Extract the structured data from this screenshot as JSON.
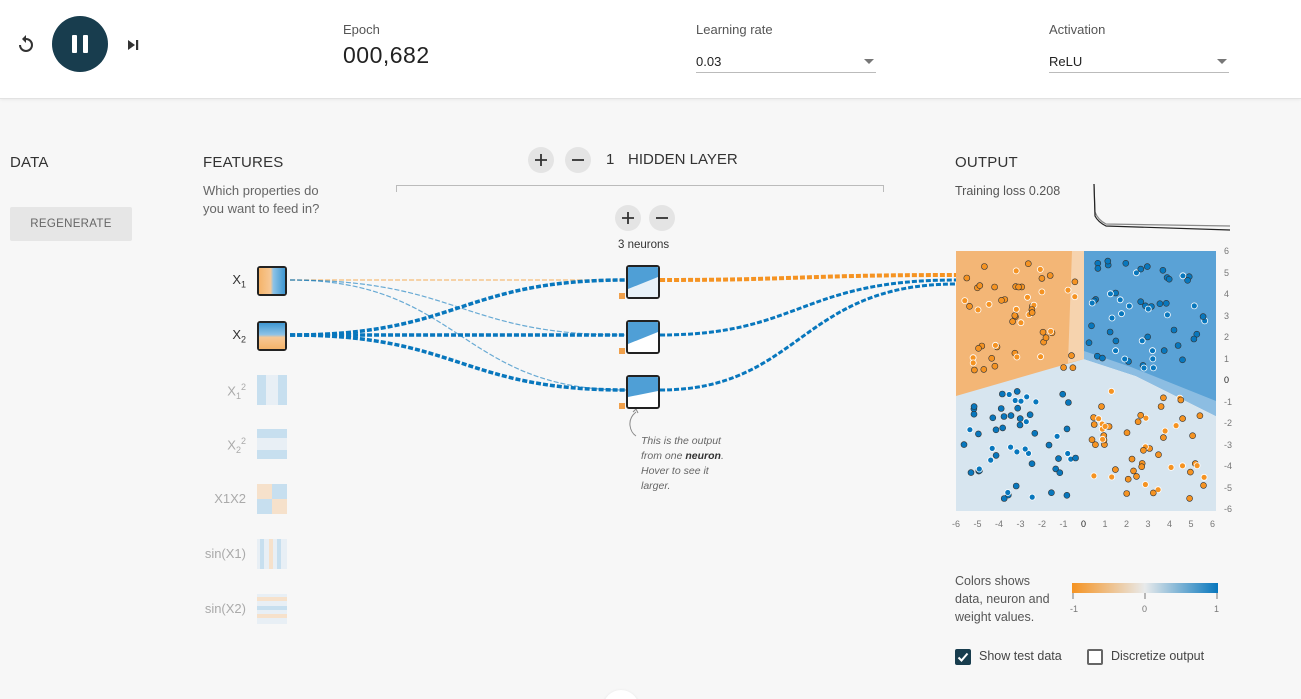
{
  "controls": {
    "reset_icon": "reset-icon",
    "play_pause_icon": "pause-icon",
    "step_icon": "step-forward-icon"
  },
  "epoch": {
    "label": "Epoch",
    "value": "000,682"
  },
  "learning_rate": {
    "label": "Learning rate",
    "value": "0.03"
  },
  "activation": {
    "label": "Activation",
    "value": "ReLU"
  },
  "data": {
    "title": "DATA",
    "regenerate_label": "REGENERATE"
  },
  "features": {
    "title": "FEATURES",
    "subtitle_line1": "Which properties do",
    "subtitle_line2": "you want to feed in?",
    "items": [
      {
        "label_base": "X",
        "label_sub": "1",
        "active": true
      },
      {
        "label_base": "X",
        "label_sub": "2",
        "active": true
      },
      {
        "label_base": "X",
        "label_sub": "1",
        "label_sup": "2",
        "active": false
      },
      {
        "label_base": "X",
        "label_sub": "2",
        "label_sup": "2",
        "active": false
      },
      {
        "label_base": "X1X2",
        "active": false
      },
      {
        "label_base": "sin(X1)",
        "active": false
      },
      {
        "label_base": "sin(X2)",
        "active": false
      }
    ]
  },
  "hidden": {
    "layer_count": "1",
    "layer_label": "HIDDEN LAYER",
    "neuron_count_label": "3 neurons",
    "note_line1": "This is the output",
    "note_line2a": "from one ",
    "note_line2b": "neuron",
    "note_line2c": ".",
    "note_line3": "Hover to see it",
    "note_line4": "larger."
  },
  "output": {
    "title": "OUTPUT",
    "loss_label": "Training loss 0.208",
    "x_ticks": [
      "-6",
      "-5",
      "-4",
      "-3",
      "-2",
      "-1",
      "0",
      "1",
      "2",
      "3",
      "4",
      "5",
      "6"
    ],
    "y_ticks": [
      "6",
      "5",
      "4",
      "3",
      "2",
      "1",
      "0",
      "-1",
      "-2",
      "-3",
      "-4",
      "-5",
      "-6"
    ],
    "legend_line1": "Colors shows",
    "legend_line2": "data, neuron and",
    "legend_line3": "weight values.",
    "legend_ticks": [
      "-1",
      "0",
      "1"
    ],
    "show_test_label": "Show test data",
    "show_test_checked": true,
    "discretize_label": "Discretize output",
    "discretize_checked": false
  },
  "colors": {
    "positive": "#0877bd",
    "negative": "#f59322",
    "nav": "#183d4e"
  }
}
